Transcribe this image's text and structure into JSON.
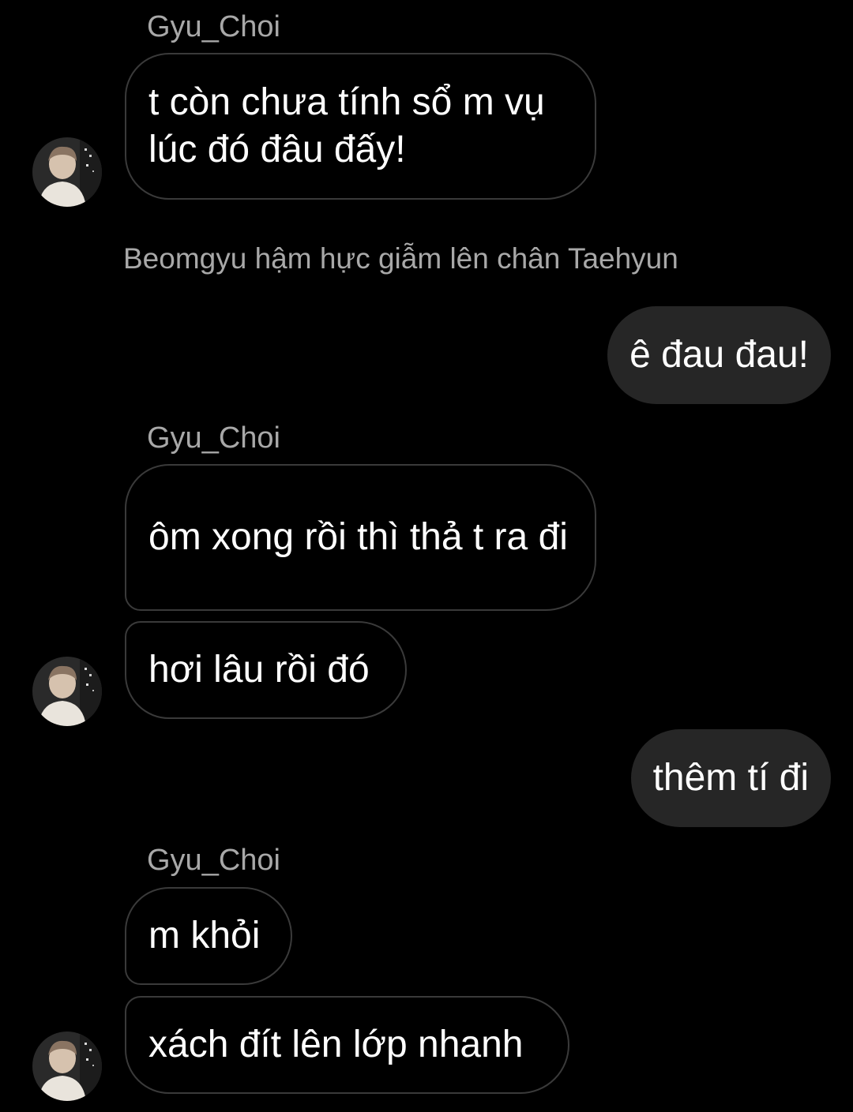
{
  "colors": {
    "background": "#000000",
    "incoming_border": "#3a3a3a",
    "outgoing_fill": "#262626",
    "meta_text": "#a8a8a8",
    "message_text": "#ffffff"
  },
  "chat": {
    "items": [
      {
        "type": "sender",
        "name": "Gyu_Choi"
      },
      {
        "type": "incoming",
        "text": "t còn chưa tính sổ m vụ lúc đó đâu đấy!"
      },
      {
        "type": "narration",
        "text": "Beomgyu hậm hực giẫm lên chân Taehyun"
      },
      {
        "type": "outgoing",
        "text": "ê đau đau!"
      },
      {
        "type": "sender",
        "name": "Gyu_Choi"
      },
      {
        "type": "incoming",
        "text": "ôm xong rồi thì thả t ra đi"
      },
      {
        "type": "incoming",
        "text": "hơi lâu rồi đó"
      },
      {
        "type": "outgoing",
        "text": "thêm tí đi"
      },
      {
        "type": "sender",
        "name": "Gyu_Choi"
      },
      {
        "type": "incoming",
        "text": "m khỏi"
      },
      {
        "type": "incoming",
        "text": "xách đít lên lớp nhanh"
      }
    ]
  }
}
